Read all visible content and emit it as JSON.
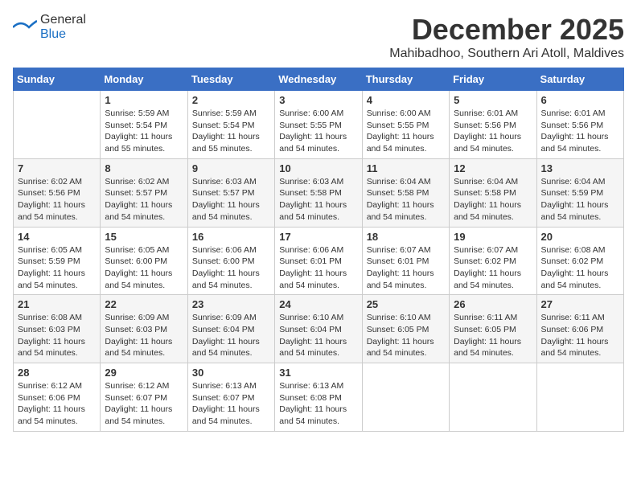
{
  "logo": {
    "text_general": "General",
    "text_blue": "Blue"
  },
  "header": {
    "month": "December 2025",
    "location": "Mahibadhoo, Southern Ari Atoll, Maldives"
  },
  "weekdays": [
    "Sunday",
    "Monday",
    "Tuesday",
    "Wednesday",
    "Thursday",
    "Friday",
    "Saturday"
  ],
  "weeks": [
    [
      {
        "day": "",
        "info": ""
      },
      {
        "day": "1",
        "info": "Sunrise: 5:59 AM\nSunset: 5:54 PM\nDaylight: 11 hours\nand 55 minutes."
      },
      {
        "day": "2",
        "info": "Sunrise: 5:59 AM\nSunset: 5:54 PM\nDaylight: 11 hours\nand 55 minutes."
      },
      {
        "day": "3",
        "info": "Sunrise: 6:00 AM\nSunset: 5:55 PM\nDaylight: 11 hours\nand 54 minutes."
      },
      {
        "day": "4",
        "info": "Sunrise: 6:00 AM\nSunset: 5:55 PM\nDaylight: 11 hours\nand 54 minutes."
      },
      {
        "day": "5",
        "info": "Sunrise: 6:01 AM\nSunset: 5:56 PM\nDaylight: 11 hours\nand 54 minutes."
      },
      {
        "day": "6",
        "info": "Sunrise: 6:01 AM\nSunset: 5:56 PM\nDaylight: 11 hours\nand 54 minutes."
      }
    ],
    [
      {
        "day": "7",
        "info": "Sunrise: 6:02 AM\nSunset: 5:56 PM\nDaylight: 11 hours\nand 54 minutes."
      },
      {
        "day": "8",
        "info": "Sunrise: 6:02 AM\nSunset: 5:57 PM\nDaylight: 11 hours\nand 54 minutes."
      },
      {
        "day": "9",
        "info": "Sunrise: 6:03 AM\nSunset: 5:57 PM\nDaylight: 11 hours\nand 54 minutes."
      },
      {
        "day": "10",
        "info": "Sunrise: 6:03 AM\nSunset: 5:58 PM\nDaylight: 11 hours\nand 54 minutes."
      },
      {
        "day": "11",
        "info": "Sunrise: 6:04 AM\nSunset: 5:58 PM\nDaylight: 11 hours\nand 54 minutes."
      },
      {
        "day": "12",
        "info": "Sunrise: 6:04 AM\nSunset: 5:58 PM\nDaylight: 11 hours\nand 54 minutes."
      },
      {
        "day": "13",
        "info": "Sunrise: 6:04 AM\nSunset: 5:59 PM\nDaylight: 11 hours\nand 54 minutes."
      }
    ],
    [
      {
        "day": "14",
        "info": "Sunrise: 6:05 AM\nSunset: 5:59 PM\nDaylight: 11 hours\nand 54 minutes."
      },
      {
        "day": "15",
        "info": "Sunrise: 6:05 AM\nSunset: 6:00 PM\nDaylight: 11 hours\nand 54 minutes."
      },
      {
        "day": "16",
        "info": "Sunrise: 6:06 AM\nSunset: 6:00 PM\nDaylight: 11 hours\nand 54 minutes."
      },
      {
        "day": "17",
        "info": "Sunrise: 6:06 AM\nSunset: 6:01 PM\nDaylight: 11 hours\nand 54 minutes."
      },
      {
        "day": "18",
        "info": "Sunrise: 6:07 AM\nSunset: 6:01 PM\nDaylight: 11 hours\nand 54 minutes."
      },
      {
        "day": "19",
        "info": "Sunrise: 6:07 AM\nSunset: 6:02 PM\nDaylight: 11 hours\nand 54 minutes."
      },
      {
        "day": "20",
        "info": "Sunrise: 6:08 AM\nSunset: 6:02 PM\nDaylight: 11 hours\nand 54 minutes."
      }
    ],
    [
      {
        "day": "21",
        "info": "Sunrise: 6:08 AM\nSunset: 6:03 PM\nDaylight: 11 hours\nand 54 minutes."
      },
      {
        "day": "22",
        "info": "Sunrise: 6:09 AM\nSunset: 6:03 PM\nDaylight: 11 hours\nand 54 minutes."
      },
      {
        "day": "23",
        "info": "Sunrise: 6:09 AM\nSunset: 6:04 PM\nDaylight: 11 hours\nand 54 minutes."
      },
      {
        "day": "24",
        "info": "Sunrise: 6:10 AM\nSunset: 6:04 PM\nDaylight: 11 hours\nand 54 minutes."
      },
      {
        "day": "25",
        "info": "Sunrise: 6:10 AM\nSunset: 6:05 PM\nDaylight: 11 hours\nand 54 minutes."
      },
      {
        "day": "26",
        "info": "Sunrise: 6:11 AM\nSunset: 6:05 PM\nDaylight: 11 hours\nand 54 minutes."
      },
      {
        "day": "27",
        "info": "Sunrise: 6:11 AM\nSunset: 6:06 PM\nDaylight: 11 hours\nand 54 minutes."
      }
    ],
    [
      {
        "day": "28",
        "info": "Sunrise: 6:12 AM\nSunset: 6:06 PM\nDaylight: 11 hours\nand 54 minutes."
      },
      {
        "day": "29",
        "info": "Sunrise: 6:12 AM\nSunset: 6:07 PM\nDaylight: 11 hours\nand 54 minutes."
      },
      {
        "day": "30",
        "info": "Sunrise: 6:13 AM\nSunset: 6:07 PM\nDaylight: 11 hours\nand 54 minutes."
      },
      {
        "day": "31",
        "info": "Sunrise: 6:13 AM\nSunset: 6:08 PM\nDaylight: 11 hours\nand 54 minutes."
      },
      {
        "day": "",
        "info": ""
      },
      {
        "day": "",
        "info": ""
      },
      {
        "day": "",
        "info": ""
      }
    ]
  ]
}
